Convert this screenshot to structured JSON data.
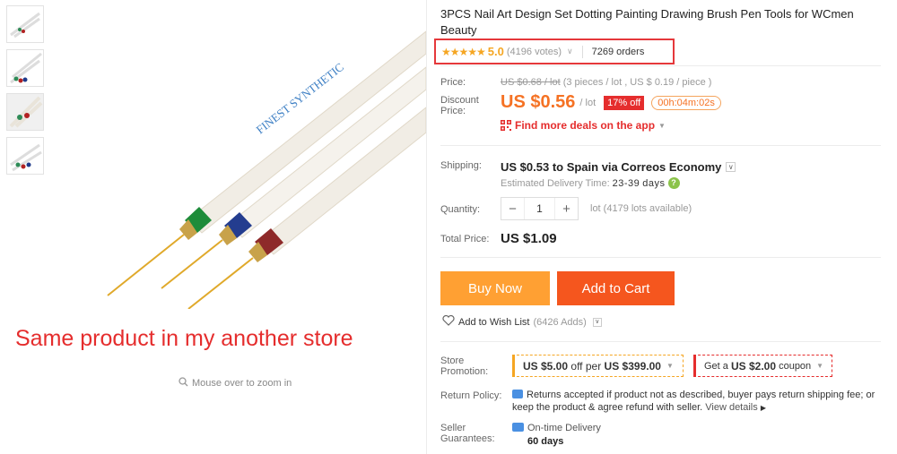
{
  "gallery": {
    "thumbnails": [
      {
        "name": "thumb-1"
      },
      {
        "name": "thumb-2"
      },
      {
        "name": "thumb-3"
      },
      {
        "name": "thumb-4"
      }
    ],
    "store_note": "Same product in my another store",
    "zoom_hint": "Mouse over to zoom in",
    "brush_text": "FINEST SYNTHETIC"
  },
  "product": {
    "title": "3PCS Nail Art Design Set Dotting Painting Drawing Brush Pen Tools for WCmen Beauty",
    "rating": {
      "stars": "★★★★★",
      "score": "5.0",
      "votes": "(4196 votes)",
      "orders": "7269 orders"
    },
    "price": {
      "label": "Price:",
      "original": "US $0.68 / lot",
      "original_detail": "(3 pieces / lot , US $ 0.19 / piece )",
      "discount_label_1": "Discount",
      "discount_label_2": "Price:",
      "current": "US $0.56",
      "unit": "/ lot",
      "off_badge": "17% off",
      "timer": "00h:04m:02s",
      "app_deals": "Find more deals on the app"
    },
    "shipping": {
      "label": "Shipping:",
      "value": "US $0.53 to Spain via Correos Economy",
      "est_label": "Estimated Delivery Time:",
      "est_value": "23-39",
      "est_unit": "days"
    },
    "quantity": {
      "label": "Quantity:",
      "value": "1",
      "minus": "−",
      "plus": "+",
      "available": "lot (4179 lots available)"
    },
    "total": {
      "label": "Total Price:",
      "value": "US $1.09"
    },
    "buttons": {
      "buy_now": "Buy Now",
      "add_to_cart": "Add to Cart"
    },
    "wishlist": {
      "label": "Add to Wish List",
      "count": "(6426 Adds)"
    },
    "promotion": {
      "label_1": "Store",
      "label_2": "Promotion:",
      "coupon1_amount": "US $5.00",
      "coupon1_mid": "off per",
      "coupon1_threshold": "US $399.00",
      "coupon2_prefix": "Get a",
      "coupon2_amount": "US $2.00",
      "coupon2_suffix": "coupon"
    },
    "return_policy": {
      "label": "Return Policy:",
      "text": "Returns accepted if product not as described, buyer pays return shipping fee; or keep the product & agree refund with seller.",
      "link": "View details"
    },
    "guarantees": {
      "label_1": "Seller",
      "label_2": "Guarantees:",
      "delivery": "On-time Delivery",
      "days": "60 days"
    }
  },
  "colors": {
    "accent_orange": "#f57224",
    "buy_now": "#ffa033",
    "add_to_cart": "#f5561e",
    "sale_red": "#e52d2d",
    "star": "#f5a623"
  }
}
